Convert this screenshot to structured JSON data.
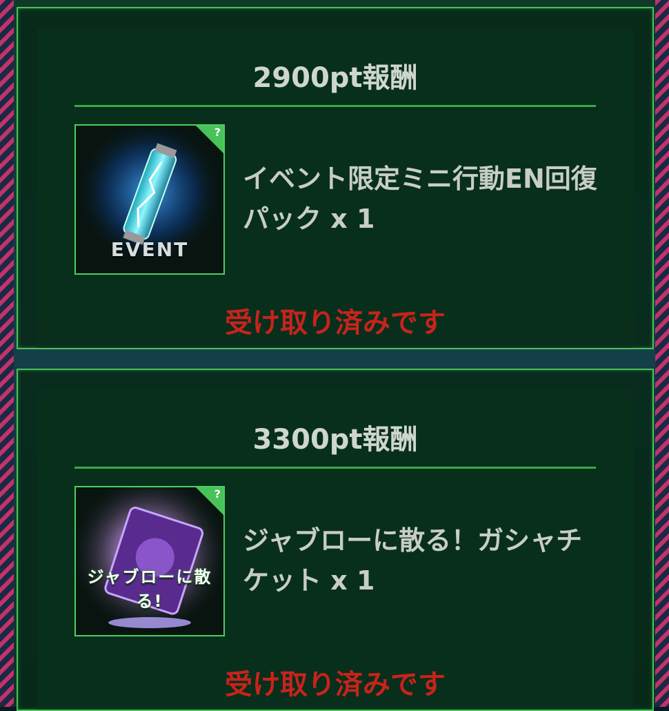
{
  "rewards": [
    {
      "title": "2900pt報酬",
      "item_name": "イベント限定ミニ行動EN回復パック x 1",
      "thumb_label": "EVENT",
      "icon": "en-battery-icon",
      "status": "受け取り済みです"
    },
    {
      "title": "3300pt報酬",
      "item_name": "ジャブローに散る！ガシャチケット x 1",
      "thumb_label": "ジャブローに散る!",
      "icon": "gacha-ticket-icon",
      "status": "受け取り済みです"
    }
  ],
  "badge": "?",
  "colors": {
    "accent": "#49c25a",
    "status": "#c8231c",
    "text": "#c8cdc8"
  }
}
